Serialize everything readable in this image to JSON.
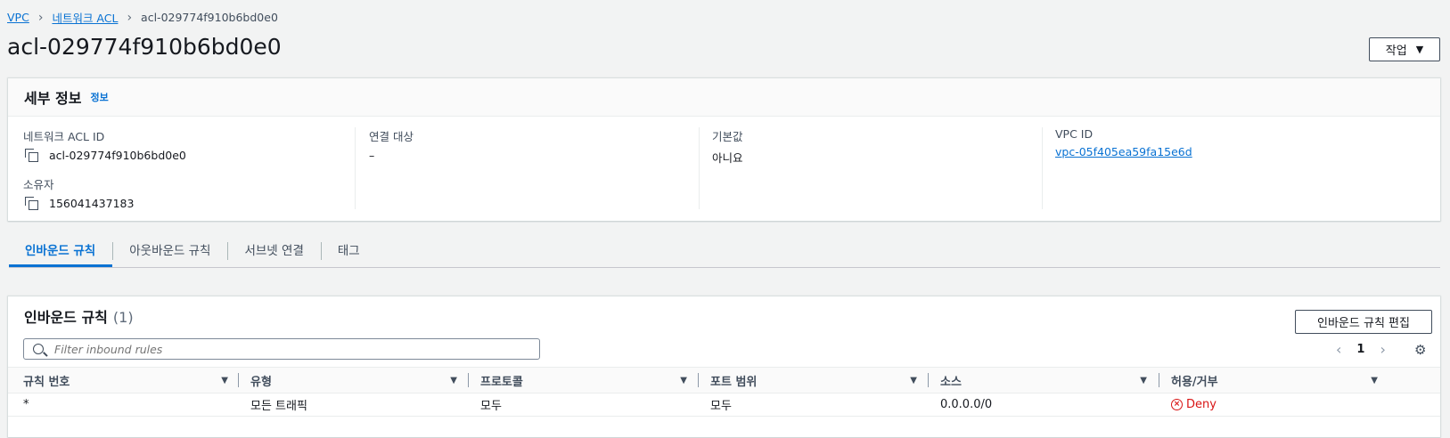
{
  "breadcrumb": {
    "items": [
      "VPC",
      "네트워크 ACL"
    ],
    "current": "acl-029774f910b6bd0e0"
  },
  "page": {
    "title": "acl-029774f910b6bd0e0",
    "actions_label": "작업"
  },
  "details": {
    "title": "세부 정보",
    "info_link": "정보",
    "acl_id_label": "네트워크 ACL ID",
    "acl_id_value": "acl-029774f910b6bd0e0",
    "owner_label": "소유자",
    "owner_value": "156041437183",
    "association_label": "연결 대상",
    "association_value": "–",
    "default_label": "기본값",
    "default_value": "아니요",
    "vpc_label": "VPC ID",
    "vpc_value": "vpc-05f405ea59fa15e6d"
  },
  "tabs": [
    "인바운드 규칙",
    "아웃바운드 규칙",
    "서브넷 연결",
    "태그"
  ],
  "rules": {
    "title": "인바운드 규칙",
    "count": "(1)",
    "edit_label": "인바운드 규칙 편집",
    "search_placeholder": "Filter inbound rules",
    "page_number": "1",
    "columns": [
      "규칙 번호",
      "유형",
      "프로토콜",
      "포트 범위",
      "소스",
      "허용/거부"
    ],
    "rows": [
      {
        "rule_no": "*",
        "type": "모든 트래픽",
        "protocol": "모두",
        "port_range": "모두",
        "source": "0.0.0.0/0",
        "action": "Deny"
      }
    ]
  },
  "colors": {
    "accent": "#0972d3",
    "deny": "#d91515",
    "background": "#f2f3f3"
  }
}
